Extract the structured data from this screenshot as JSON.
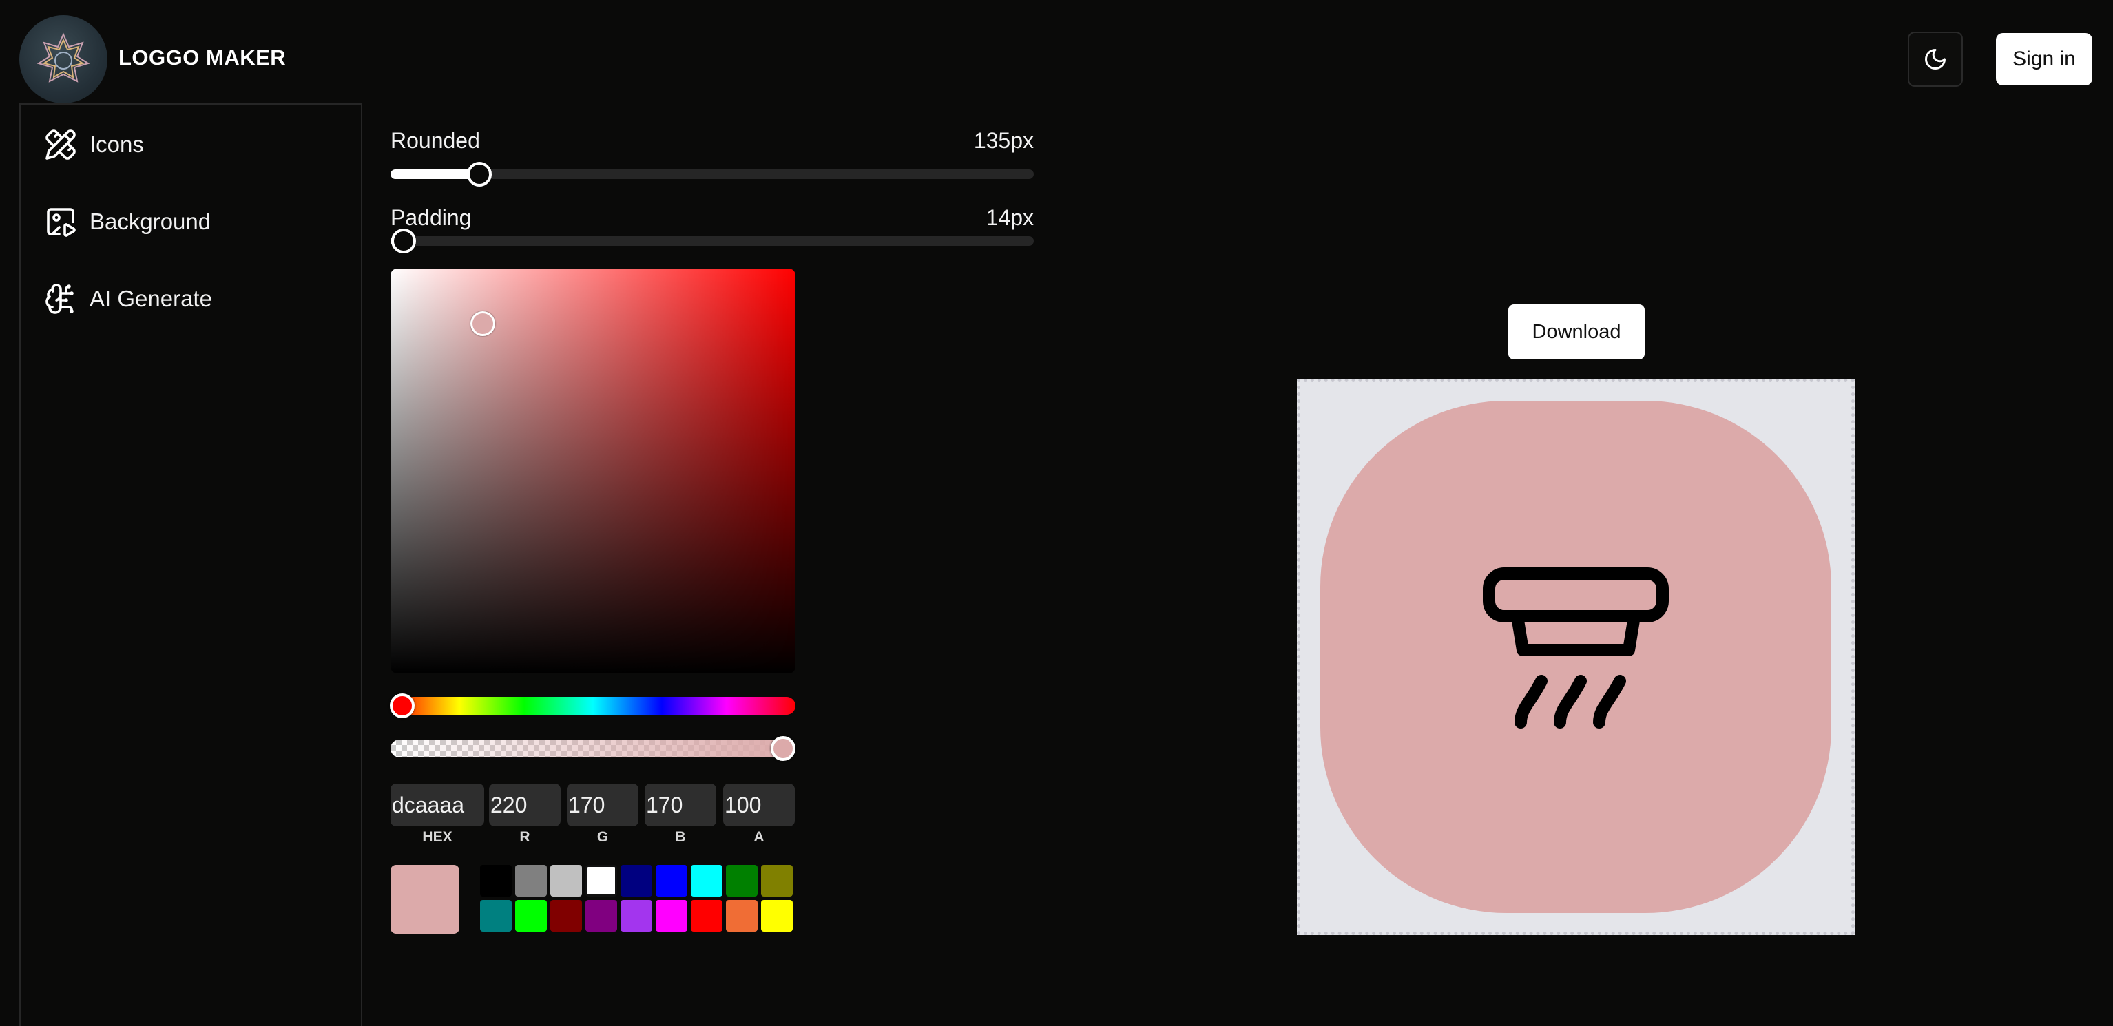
{
  "header": {
    "brand": "LOGGO MAKER",
    "sign_in_label": "Sign in",
    "theme_icon": "moon-icon"
  },
  "sidebar": {
    "items": [
      {
        "label": "Icons",
        "icon": "pencil-ruler-icon"
      },
      {
        "label": "Background",
        "icon": "image-play-icon"
      },
      {
        "label": "AI Generate",
        "icon": "brain-circuit-icon"
      }
    ]
  },
  "controls": {
    "rounded": {
      "label": "Rounded",
      "value_text": "135px",
      "value": 135
    },
    "padding": {
      "label": "Padding",
      "value_text": "14px",
      "value": 14
    }
  },
  "color_picker": {
    "hex": "dcaaaa",
    "r": "220",
    "g": "170",
    "b": "170",
    "a": "100",
    "labels": {
      "hex": "HEX",
      "r": "R",
      "g": "G",
      "b": "B",
      "a": "A"
    },
    "current_color": "#dcaaaa",
    "hue_color": "#ff0000",
    "presets": [
      "#000000",
      "#808080",
      "#c0c0c0",
      "#ffffff",
      "#000080",
      "#0000ff",
      "#00ffff",
      "#008000",
      "#808000",
      "#008080",
      "#00ff00",
      "#800000",
      "#800080",
      "#a335ee",
      "#ff00ff",
      "#ff0000",
      "#f06d35",
      "#ffff00"
    ]
  },
  "preview": {
    "download_label": "Download",
    "canvas_background": "#e4e5ea",
    "logo_background": "#dcaaaa",
    "logo_icon": "range-hood-icon",
    "icon_color": "#000000"
  }
}
